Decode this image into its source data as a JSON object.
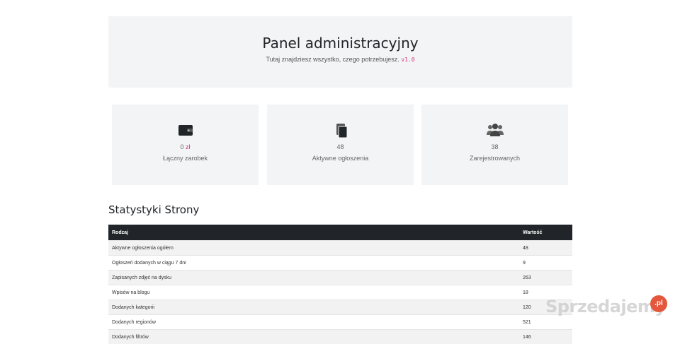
{
  "header": {
    "title": "Panel administracyjny",
    "subtitle": "Tutaj znajdziesz wszystko, czego potrzebujesz.",
    "version": "v1.0"
  },
  "cards": [
    {
      "icon": "wallet-icon",
      "value": "0",
      "currency": "zł",
      "label": "Łączny zarobek"
    },
    {
      "icon": "copy-icon",
      "value": "48",
      "label": "Aktywne ogłoszenia"
    },
    {
      "icon": "users-icon",
      "value": "38",
      "label": "Zarejestrowanych"
    }
  ],
  "stats": {
    "title": "Statystyki Strony",
    "columns": [
      "Rodzaj",
      "Wartość"
    ],
    "rows": [
      [
        "Aktywne ogłoszenia ogółem",
        "48"
      ],
      [
        "Ogłoszeń dodanych w ciągu 7 dni",
        "9"
      ],
      [
        "Zapisanych zdjęć na dysku",
        "263"
      ],
      [
        "Wpisów na blogu",
        "18"
      ],
      [
        "Dodanych kategorii",
        "120"
      ],
      [
        "Dodanych regionów",
        "521"
      ],
      [
        "Dodanych filtrów",
        "146"
      ]
    ]
  },
  "watermark": {
    "brand": "Sprzedajemy",
    "badge": ".pl"
  },
  "colors": {
    "accent": "#d63384",
    "dark": "#212529",
    "panel": "#f3f4f5"
  }
}
